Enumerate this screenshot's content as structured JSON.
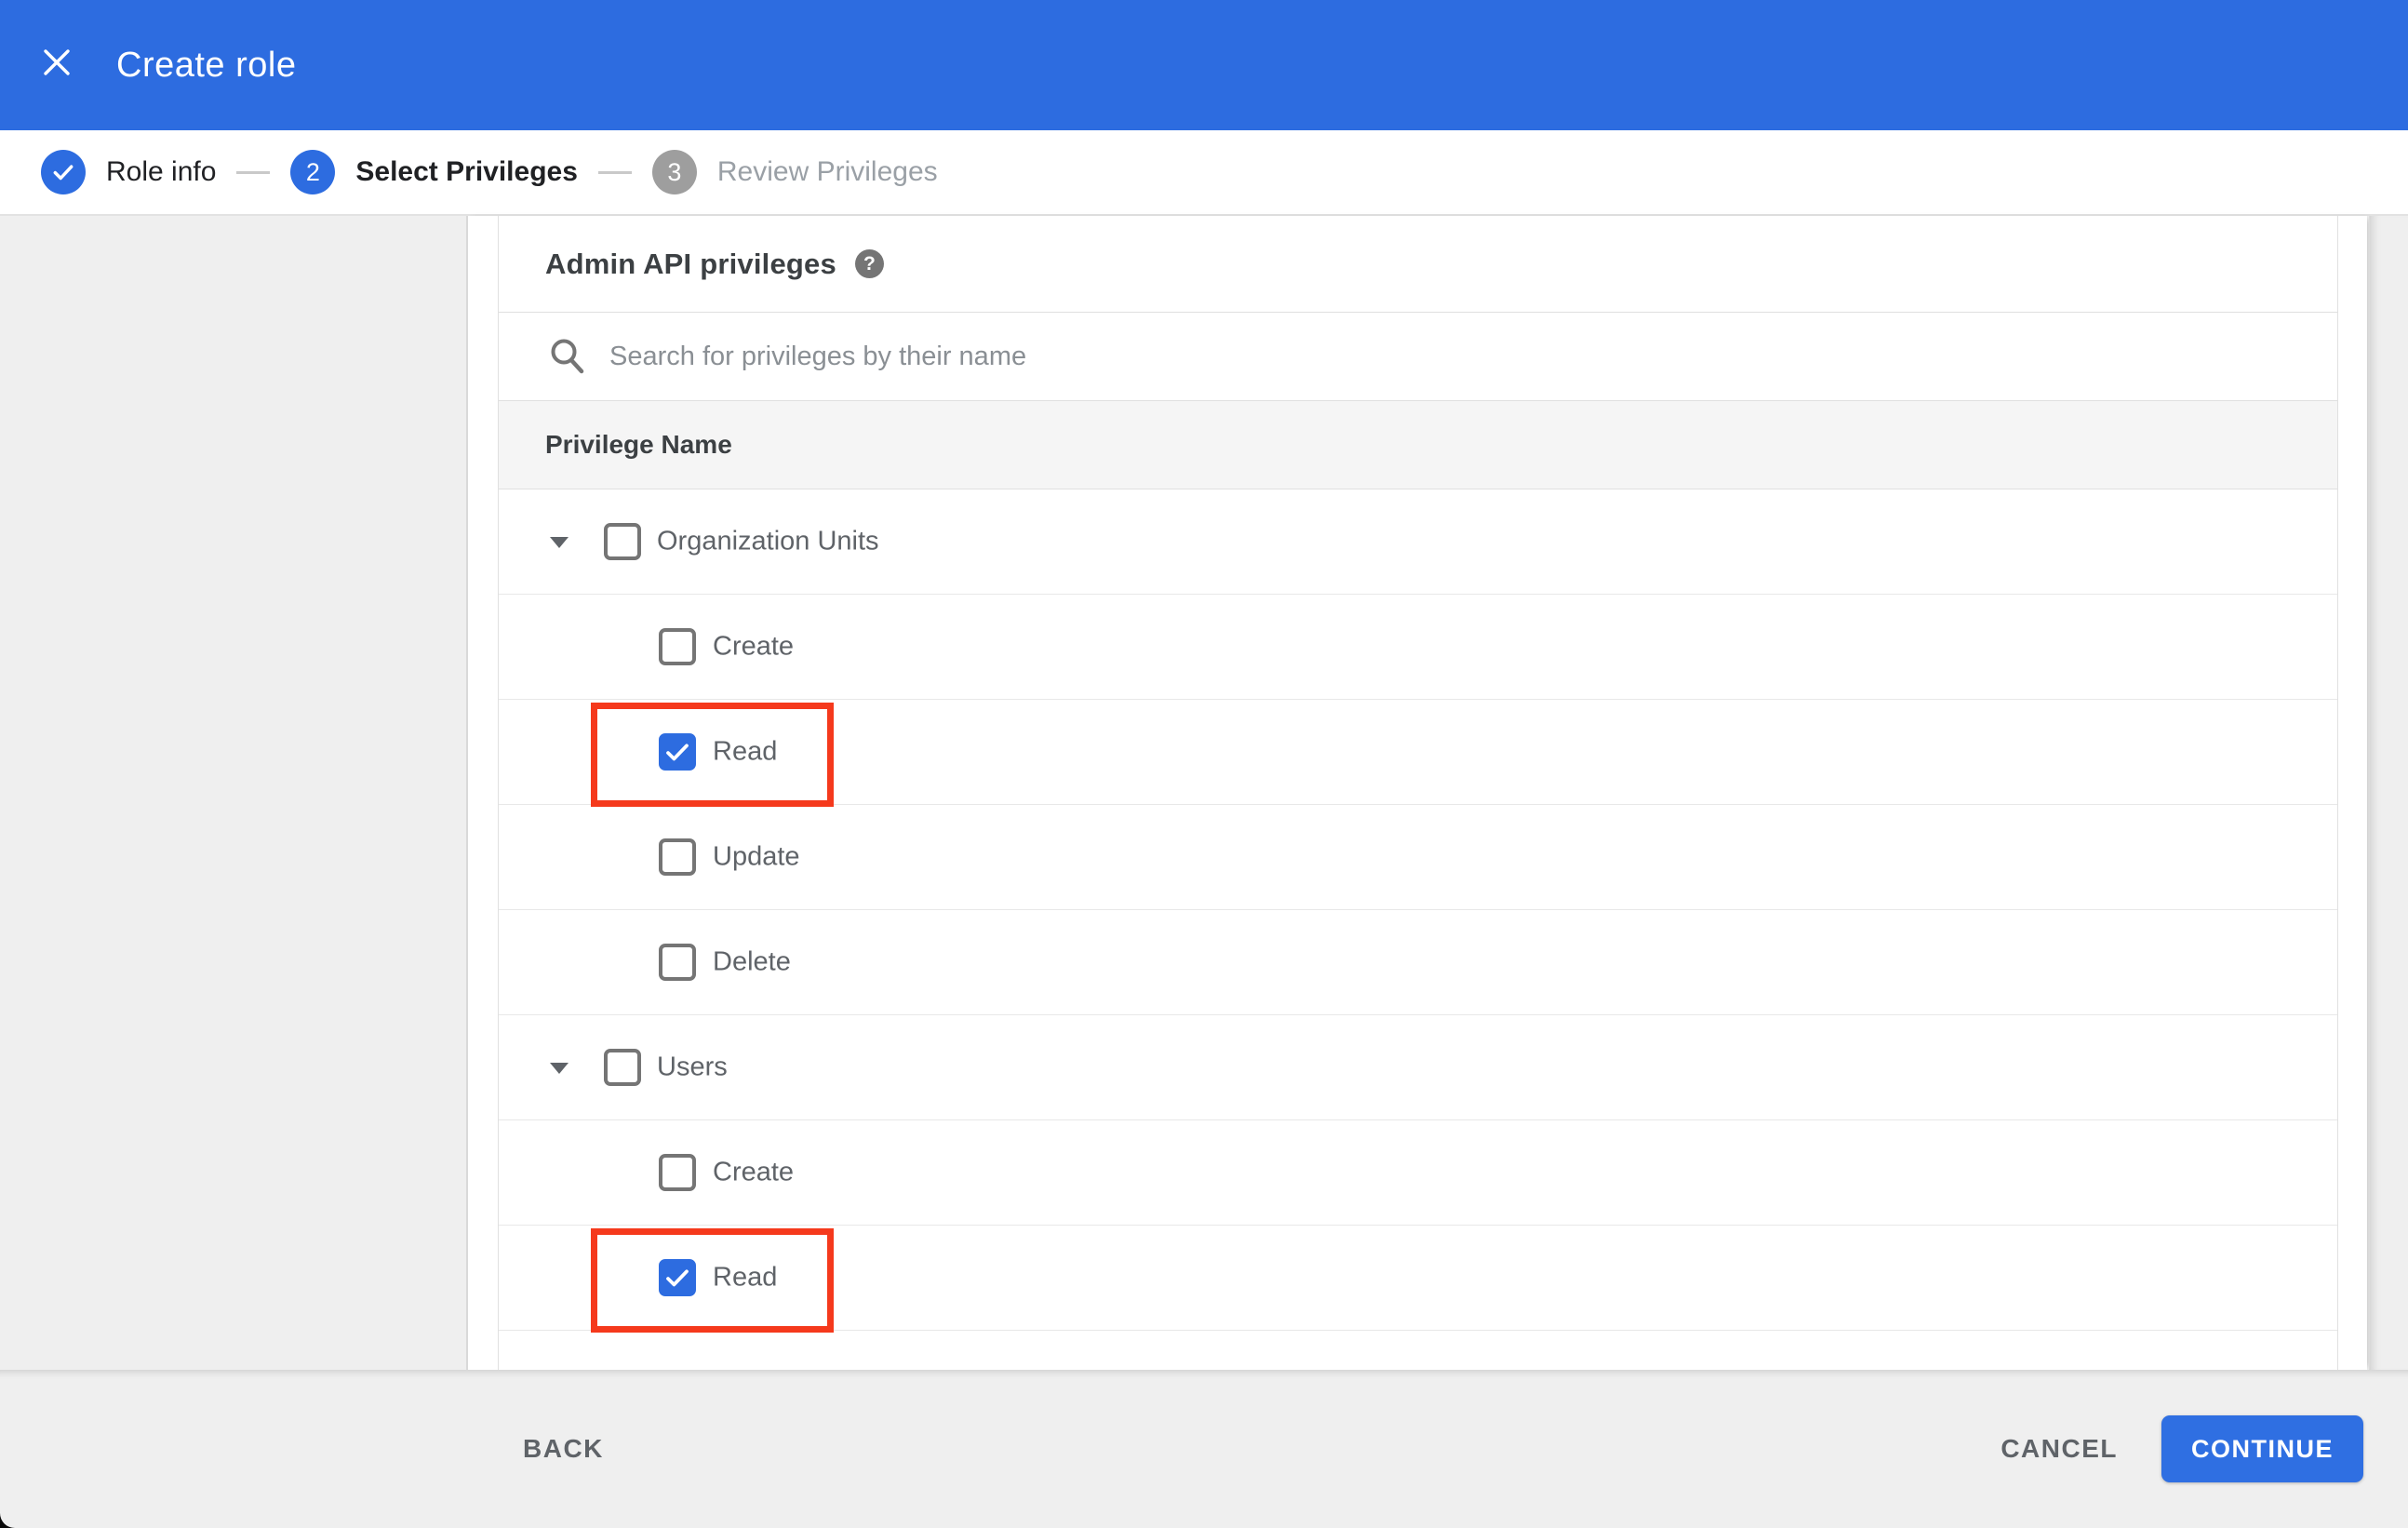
{
  "titlebar": {
    "title": "Create role"
  },
  "stepper": {
    "steps": [
      {
        "number": "1",
        "label": "Role info",
        "state": "completed"
      },
      {
        "number": "2",
        "label": "Select Privileges",
        "state": "active"
      },
      {
        "number": "3",
        "label": "Review Privileges",
        "state": "upcoming"
      }
    ]
  },
  "content": {
    "heading": "Admin API privileges",
    "help_icon": "help-question-icon",
    "search": {
      "placeholder": "Search for privileges by their name",
      "value": "",
      "icon": "search-icon"
    },
    "table": {
      "column_header": "Privilege Name",
      "rows": [
        {
          "label": "Organization Units",
          "level": 0,
          "expandable": true,
          "checked": false,
          "highlighted": false
        },
        {
          "label": "Create",
          "level": 1,
          "expandable": false,
          "checked": false,
          "highlighted": false
        },
        {
          "label": "Read",
          "level": 1,
          "expandable": false,
          "checked": true,
          "highlighted": true
        },
        {
          "label": "Update",
          "level": 1,
          "expandable": false,
          "checked": false,
          "highlighted": false
        },
        {
          "label": "Delete",
          "level": 1,
          "expandable": false,
          "checked": false,
          "highlighted": false
        },
        {
          "label": "Users",
          "level": 0,
          "expandable": true,
          "checked": false,
          "highlighted": false
        },
        {
          "label": "Create",
          "level": 1,
          "expandable": false,
          "checked": false,
          "highlighted": false
        },
        {
          "label": "Read",
          "level": 1,
          "expandable": false,
          "checked": true,
          "highlighted": true
        }
      ]
    }
  },
  "footer": {
    "back_label": "BACK",
    "cancel_label": "CANCEL",
    "continue_label": "CONTINUE"
  },
  "colors": {
    "primary_blue": "#2d6ce0",
    "highlight_red": "#f5391c",
    "inactive_step_gray": "#9e9e9e",
    "page_background": "#efefef"
  }
}
